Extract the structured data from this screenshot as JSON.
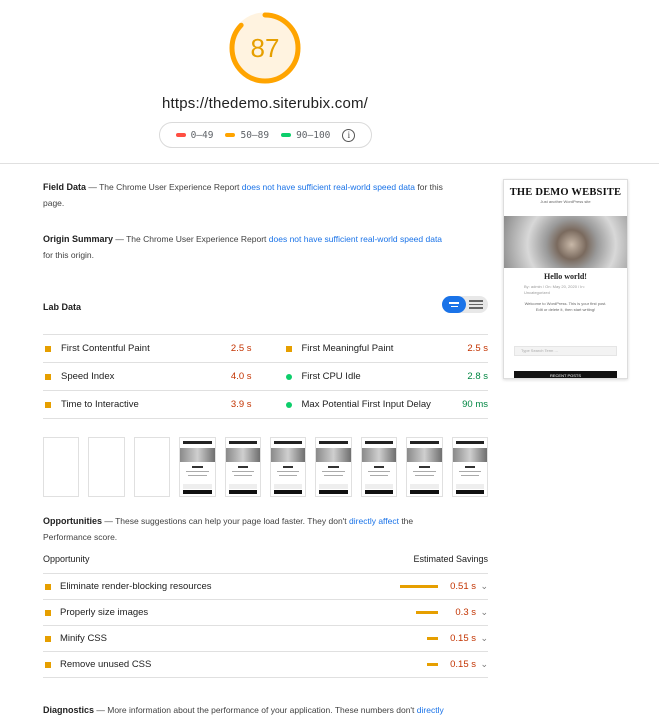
{
  "header": {
    "score": "87",
    "score_fraction": 0.87,
    "url": "https://thedemo.siterubix.com/",
    "legend": [
      {
        "range": "0–49",
        "color": "#ff4e42"
      },
      {
        "range": "50–89",
        "color": "#ffa400"
      },
      {
        "range": "90–100",
        "color": "#0cce6b"
      }
    ]
  },
  "field_data": {
    "title": "Field Data",
    "text_before": " — The Chrome User Experience Report ",
    "link": "does not have sufficient real-world speed data",
    "text_after": " for this page."
  },
  "origin_summary": {
    "title": "Origin Summary",
    "text_before": " — The Chrome User Experience Report ",
    "link": "does not have sufficient real-world speed data",
    "text_after": " for this origin."
  },
  "lab_data": {
    "title": "Lab Data",
    "metrics": [
      {
        "name": "First Contentful Paint",
        "value": "2.5 s",
        "status": "average"
      },
      {
        "name": "First Meaningful Paint",
        "value": "2.5 s",
        "status": "average"
      },
      {
        "name": "Speed Index",
        "value": "4.0 s",
        "status": "average"
      },
      {
        "name": "First CPU Idle",
        "value": "2.8 s",
        "status": "pass"
      },
      {
        "name": "Time to Interactive",
        "value": "3.9 s",
        "status": "average"
      },
      {
        "name": "Max Potential First Input Delay",
        "value": "90 ms",
        "status": "pass"
      }
    ]
  },
  "opportunities": {
    "title": "Opportunities",
    "text_before": " — These suggestions can help your page load faster. They don't ",
    "link": "directly affect",
    "text_after": " the Performance score.",
    "col_opportunity": "Opportunity",
    "col_savings": "Estimated Savings",
    "items": [
      {
        "name": "Eliminate render-blocking resources",
        "savings": "0.51 s",
        "bar_fraction": 1.0
      },
      {
        "name": "Properly size images",
        "savings": "0.3 s",
        "bar_fraction": 0.59
      },
      {
        "name": "Minify CSS",
        "savings": "0.15 s",
        "bar_fraction": 0.3
      },
      {
        "name": "Remove unused CSS",
        "savings": "0.15 s",
        "bar_fraction": 0.3
      }
    ]
  },
  "diagnostics": {
    "title": "Diagnostics",
    "text_before": " — More information about the performance of your application. These numbers don't ",
    "link": "directly"
  },
  "thumbnail": {
    "site_title": "THE DEMO WEBSITE",
    "site_tagline": "Just another WordPress site",
    "post_title": "Hello world!",
    "meta": "By: admin  /  On: May 20, 2020  /  In: Uncategorized",
    "excerpt": "Welcome to WordPress. This is your first post. Edit or delete it, then start writing!",
    "search_placeholder": "Type Search Term ...",
    "recent_posts": "RECENT POSTS"
  },
  "colors": {
    "average": "#e69f00",
    "pass": "#0cce6b",
    "fail": "#ff4e42",
    "average_text": "#c33300",
    "pass_text": "#018642"
  }
}
